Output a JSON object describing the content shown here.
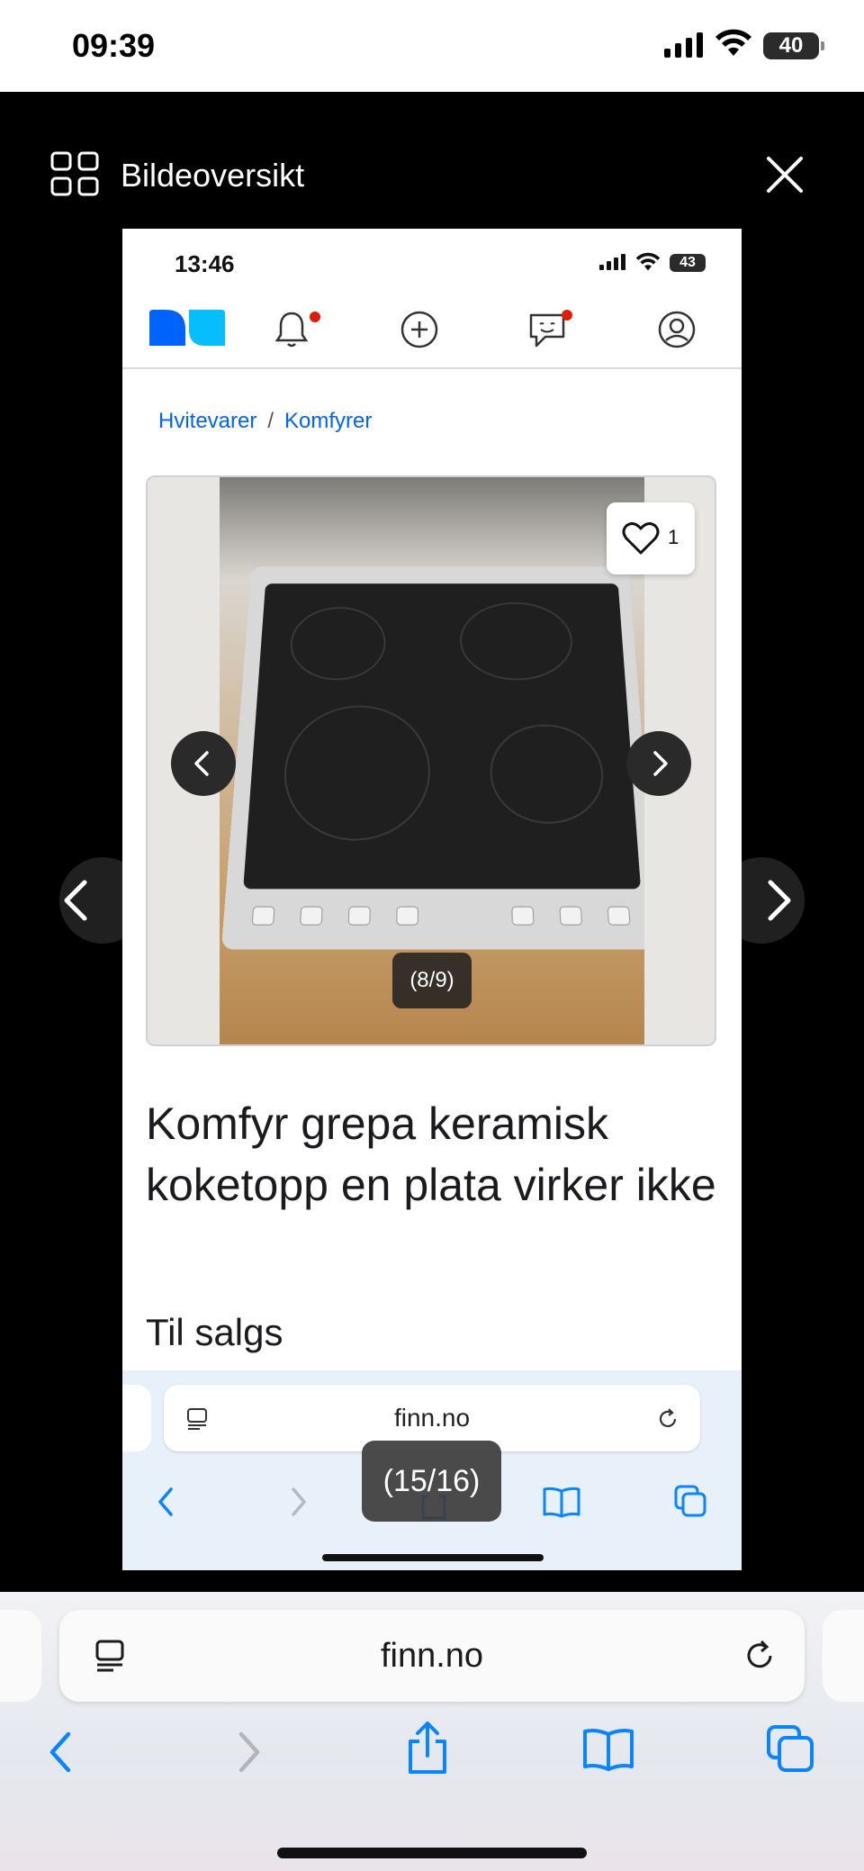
{
  "status_bar": {
    "time": "09:39",
    "battery": "40"
  },
  "overview": {
    "title": "Bildeoversikt",
    "page_counter": "(15/16)"
  },
  "screenshot": {
    "status_bar": {
      "time": "13:46",
      "battery": "43"
    },
    "breadcrumb": [
      "Hvitevarer",
      "Komfyrer"
    ],
    "breadcrumb_separator": "/",
    "gallery": {
      "counter": "(8/9)",
      "likes": "1"
    },
    "listing": {
      "title": "Komfyr grepa keramisk koketopp en plata virker ikke",
      "status": "Til salgs"
    },
    "browser": {
      "url": "finn.no"
    }
  },
  "browser": {
    "url": "finn.no",
    "accent_color": "#0a84ff"
  },
  "colors": {
    "finn_blue_dark": "#0063fb",
    "finn_blue_light": "#06befb",
    "notification_dot": "#d91f0a"
  }
}
